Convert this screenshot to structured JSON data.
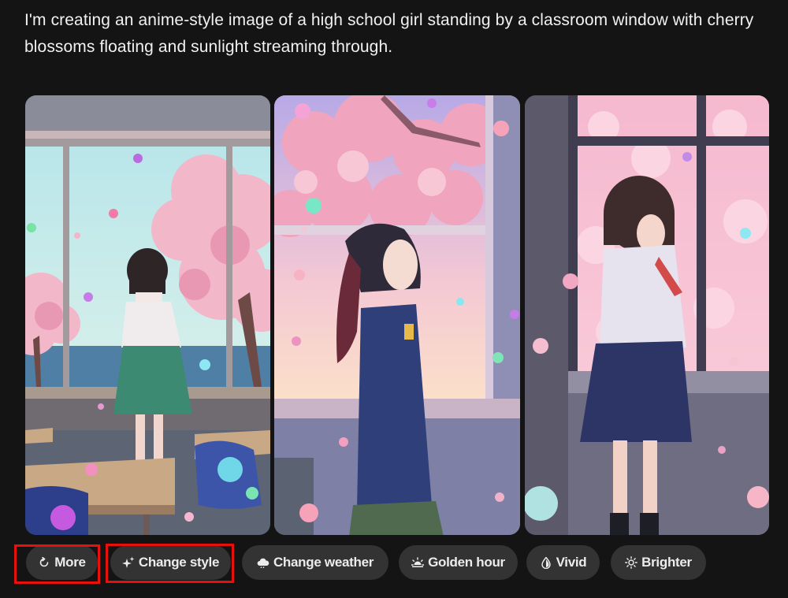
{
  "prompt": {
    "text": "I'm creating an anime-style image of a high school girl standing by a classroom window with cherry blossoms floating and sunlight streaming through."
  },
  "gallery": {
    "images": [
      {
        "name": "classroom-window-image-1"
      },
      {
        "name": "classroom-window-image-2"
      },
      {
        "name": "classroom-window-image-3"
      }
    ]
  },
  "actions": {
    "more": {
      "label": "More",
      "icon": "refresh-icon"
    },
    "change_style": {
      "label": "Change style",
      "icon": "sparkle-icon"
    },
    "change_weather": {
      "label": "Change weather",
      "icon": "cloud-icon"
    },
    "golden_hour": {
      "label": "Golden hour",
      "icon": "sunrise-icon"
    },
    "vivid": {
      "label": "Vivid",
      "icon": "drop-icon"
    },
    "brighter": {
      "label": "Brighter",
      "icon": "sun-icon"
    }
  },
  "colors": {
    "background": "#141414",
    "chip": "#333333",
    "highlight": "#e8100d"
  }
}
